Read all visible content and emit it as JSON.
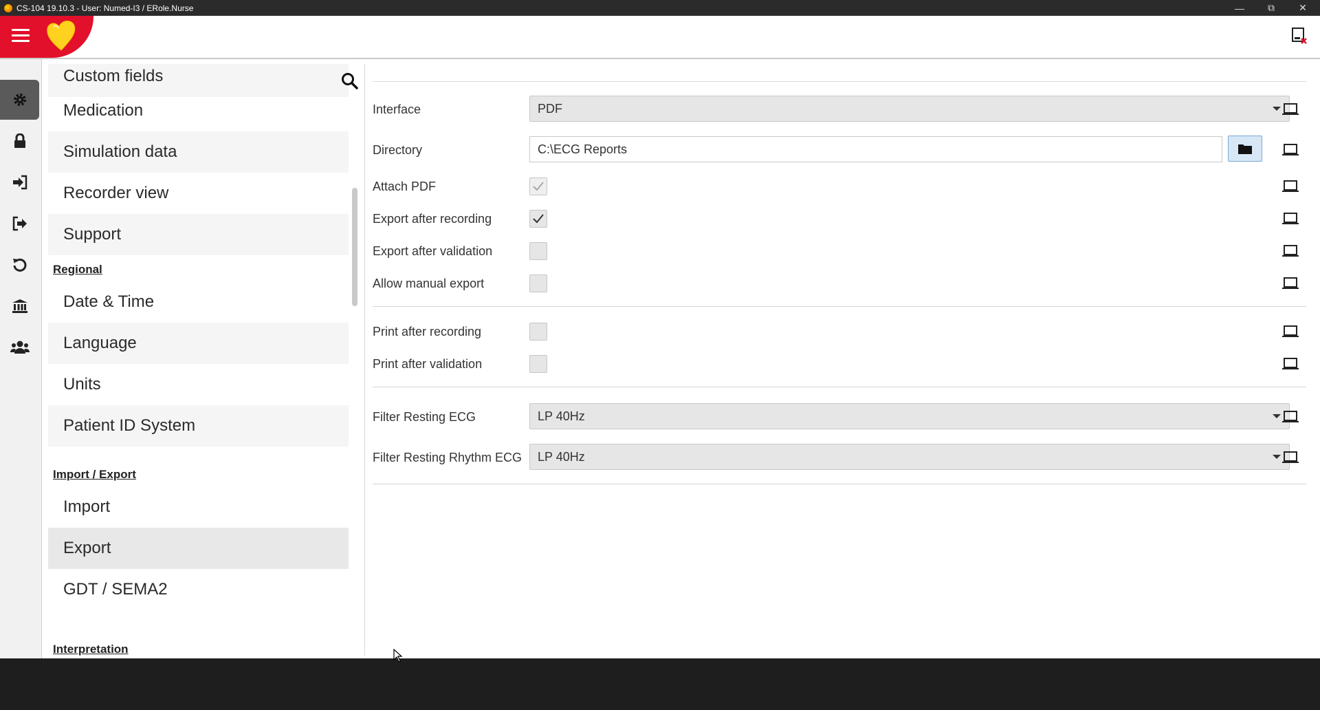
{
  "window": {
    "title": "CS-104 19.10.3 - User: Numed-I3 / ERole.Nurse",
    "controls": [
      "minimize",
      "restore",
      "close"
    ]
  },
  "header": {
    "menu_icon": "hamburger-icon",
    "logo_icon": "heart-logo",
    "right_icon": "device-disconnected-icon"
  },
  "rail": {
    "items": [
      {
        "icon": "gear-icon",
        "active": true
      },
      {
        "icon": "lock-icon"
      },
      {
        "icon": "sign-in-icon"
      },
      {
        "icon": "sign-out-icon"
      },
      {
        "icon": "undo-icon"
      },
      {
        "icon": "institution-icon"
      },
      {
        "icon": "users-icon"
      }
    ]
  },
  "nav": {
    "items_top": [
      "Custom fields",
      "Medication",
      "Simulation data",
      "Recorder view",
      "Support"
    ],
    "section_regional": "Regional",
    "items_regional": [
      "Date & Time",
      "Language",
      "Units",
      "Patient ID System"
    ],
    "section_import_export": "Import / Export",
    "items_import_export": [
      "Import",
      "Export",
      "GDT / SEMA2"
    ],
    "section_interpretation": "Interpretation",
    "selected": "Export"
  },
  "settings": {
    "interface": {
      "label": "Interface",
      "value": "PDF"
    },
    "directory": {
      "label": "Directory",
      "value": "C:\\ECG Reports"
    },
    "attach_pdf": {
      "label": "Attach PDF",
      "checked": true,
      "disabled": true
    },
    "export_after_recording": {
      "label": "Export after recording",
      "checked": true
    },
    "export_after_validation": {
      "label": "Export after validation",
      "checked": false
    },
    "allow_manual_export": {
      "label": "Allow manual export",
      "checked": false
    },
    "print_after_recording": {
      "label": "Print after recording",
      "checked": false
    },
    "print_after_validation": {
      "label": "Print after validation",
      "checked": false
    },
    "filter_resting_ecg": {
      "label": "Filter Resting ECG",
      "value": "LP 40Hz"
    },
    "filter_resting_rhythm_ecg": {
      "label": "Filter Resting Rhythm ECG",
      "value": "LP 40Hz"
    }
  },
  "colors": {
    "brand_red": "#e2102a",
    "heart_yellow": "#ffd21f",
    "folder_button_bg": "#d7e7f5"
  }
}
